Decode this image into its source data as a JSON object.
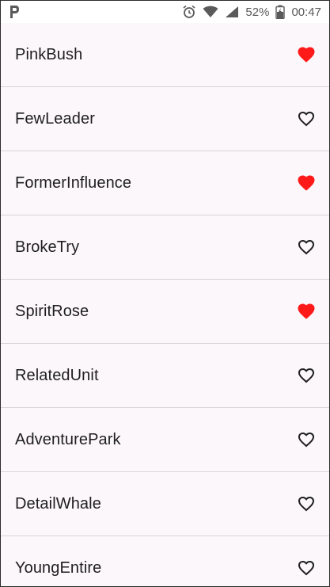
{
  "status_bar": {
    "app_icon": "p-logo-icon",
    "icons": [
      "alarm-icon",
      "wifi-icon",
      "signal-icon"
    ],
    "battery_percent": "52%",
    "battery_icon": "battery-charging-icon",
    "time": "00:47"
  },
  "list": {
    "items": [
      {
        "label": "PinkBush",
        "favorite": true
      },
      {
        "label": "FewLeader",
        "favorite": false
      },
      {
        "label": "FormerInfluence",
        "favorite": true
      },
      {
        "label": "BrokeTry",
        "favorite": false
      },
      {
        "label": "SpiritRose",
        "favorite": true
      },
      {
        "label": "RelatedUnit",
        "favorite": false
      },
      {
        "label": "AdventurePark",
        "favorite": false
      },
      {
        "label": "DetailWhale",
        "favorite": false
      },
      {
        "label": "YoungEntire",
        "favorite": false
      }
    ]
  },
  "colors": {
    "favorite_heart": "#ff1a1a",
    "outline_heart": "#1f1f1f",
    "background": "#fbf7fb",
    "divider": "#d8d4d8"
  }
}
